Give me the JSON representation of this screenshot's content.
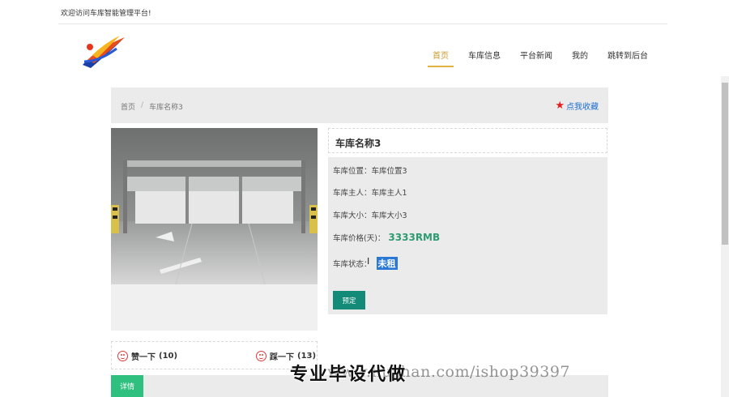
{
  "topbar": {
    "welcome": "欢迎访问车库智能管理平台!"
  },
  "nav": {
    "items": [
      "首页",
      "车库信息",
      "平台新闻",
      "我的",
      "跳转到后台"
    ],
    "active_index": 0
  },
  "breadcrumb": {
    "home": "首页",
    "sep": "/",
    "current": "车库名称3"
  },
  "favorite": {
    "label": "点我收藏",
    "icon": "star-icon"
  },
  "garage": {
    "name": "车库名称3",
    "location_label": "车库位置：",
    "location": "车库位置3",
    "owner_label": "车库主人：",
    "owner": "车库主人1",
    "size_label": "车库大小：",
    "size": "车库大小3",
    "price_label": "车库价格(天)：",
    "price": "3333RMB",
    "status_label": "车库状态：",
    "status": "未租"
  },
  "actions": {
    "book": "预定"
  },
  "votes": {
    "like_label": "赞一下",
    "like_count": "(10)",
    "dislike_label": "踩一下",
    "dislike_count": "(13)"
  },
  "tabs": {
    "detail": "详情"
  },
  "watermark": {
    "text": "专业毕设代做",
    "url": "www.huzhan.com/ishop39397"
  },
  "colors": {
    "accent": "#e0b43c",
    "book_button": "#148b78",
    "detail_tab": "#2fbf7f",
    "price": "#2e9b74",
    "link": "#1e6fd1"
  }
}
